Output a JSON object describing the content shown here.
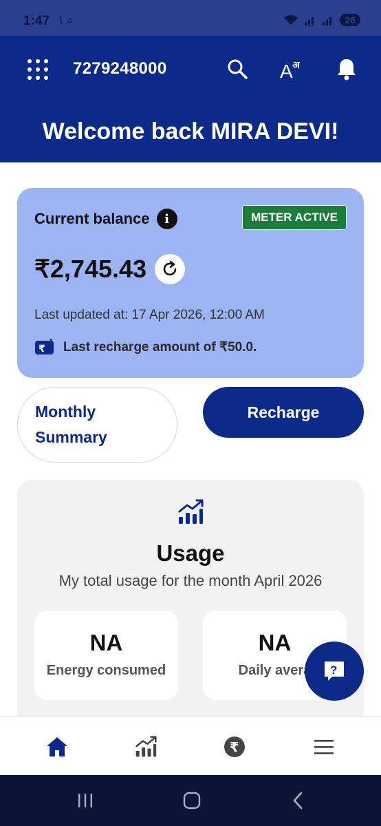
{
  "status_bar": {
    "time": "1:47",
    "left_icons": [
      "missed-call-icon",
      "search-notification-icon"
    ],
    "battery": "26"
  },
  "header": {
    "phone_number": "7279248000",
    "welcome": "Welcome back MIRA DEVI!",
    "icons": [
      "grid-menu-icon",
      "search-icon",
      "language-icon",
      "bell-icon"
    ]
  },
  "balance": {
    "title": "Current balance",
    "status_badge": "METER ACTIVE",
    "amount": "₹2,745.43",
    "last_updated": "Last updated at: 17 Apr 2026, 12:00 AM",
    "last_recharge": "Last recharge amount of ₹50.0."
  },
  "actions": {
    "monthly_line1": "Monthly",
    "monthly_line2": "Summary",
    "recharge": "Recharge"
  },
  "usage": {
    "title": "Usage",
    "subtitle": "My total usage for the month April 2026",
    "stats": [
      {
        "value": "NA",
        "label": "Energy consumed"
      },
      {
        "value": "NA",
        "label": "Daily avera"
      }
    ]
  },
  "bottom_nav": [
    "home-icon",
    "usage-chart-icon",
    "rupee-icon",
    "menu-icon"
  ],
  "colors": {
    "primary": "#0b2a8a",
    "balance_card": "#9db4f3",
    "active_badge": "#1b7d3a"
  }
}
